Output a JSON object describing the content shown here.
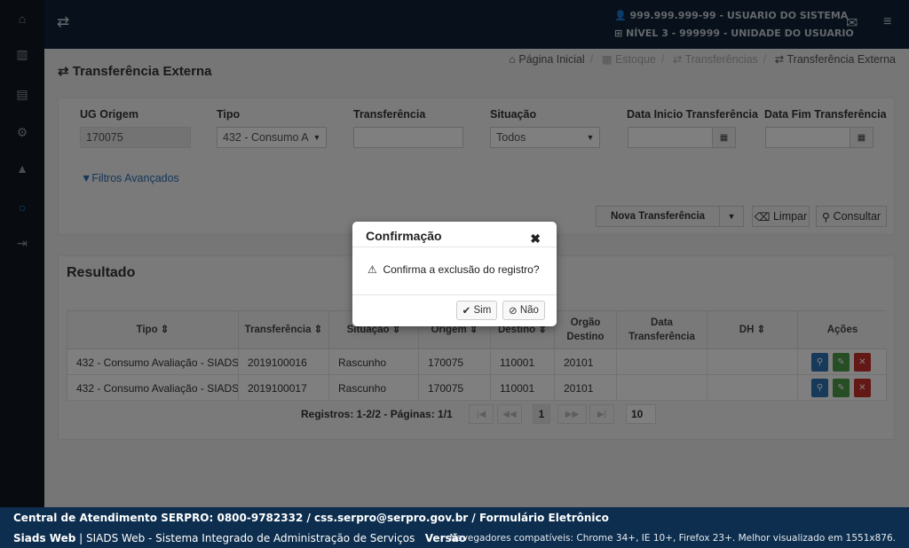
{
  "topbar": {
    "user": "999.999.999-99 - USUARIO DO SISTEMA",
    "unit": "NÍVEL 3 - 999999 - UNIDADE DO USUARIO"
  },
  "page": {
    "title": "Transferência Externa"
  },
  "breadcrumb": [
    "Página Inicial",
    "Estoque",
    "Transferências",
    "Transferência Externa"
  ],
  "filters": {
    "ug_label": "UG Origem",
    "ug_value": "170075",
    "tipo_label": "Tipo",
    "tipo_value": "432 - Consumo A",
    "transf_label": "Transferência",
    "transf_value": "",
    "situacao_label": "Situação",
    "situacao_value": "Todos",
    "data_ini_label": "Data Inicio Transferência",
    "data_fim_label": "Data Fim Transferência",
    "advanced": "Filtros Avançados"
  },
  "actions": {
    "nova": "Nova Transferência",
    "limpar": "Limpar",
    "consultar": "Consultar"
  },
  "result": {
    "title": "Resultado",
    "columns": [
      "Tipo",
      "Transferência",
      "Situação",
      "Origem",
      "Destino",
      "Orgão Destino",
      "Data Transferência",
      "DH",
      "Ações"
    ],
    "rows": [
      [
        "432 - Consumo Avaliação - SIADS",
        "2019100016",
        "Rascunho",
        "170075",
        "110001",
        "20101",
        "",
        ""
      ],
      [
        "432 - Consumo Avaliação - SIADS",
        "2019100017",
        "Rascunho",
        "170075",
        "110001",
        "20101",
        "",
        ""
      ]
    ],
    "pager_text": "Registros: 1-2/2 - Páginas: 1/1",
    "current_page": "1",
    "page_size": "10"
  },
  "modal": {
    "title": "Confirmação",
    "message": "Confirma a exclusão do registro?",
    "yes": "Sim",
    "no": "Não"
  },
  "footer": {
    "contact": "Central de Atendimento SERPRO: 0800-9782332 / css.serpro@serpro.gov.br / Formulário Eletrônico",
    "app_name": "Siads Web",
    "app_desc": "| SIADS Web - Sistema Integrado de Administração de Serviços",
    "version_label": "Versão",
    "browsers": "Navegadores compatíveis: Chrome 34+, IE 10+, Firefox 23+. Melhor visualizado em 1551x876."
  },
  "colors": {
    "topbar": "#0e2136",
    "footer": "#0d2e4e",
    "sidebar": "#111820",
    "link": "#2a6fb5"
  }
}
